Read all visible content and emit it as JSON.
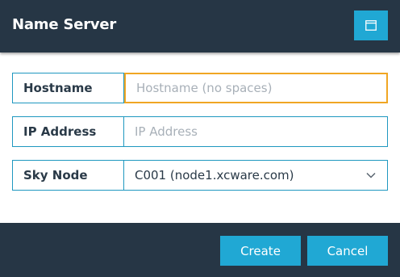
{
  "dialog": {
    "title": "Name Server"
  },
  "fields": {
    "hostname": {
      "label": "Hostname",
      "value": "",
      "placeholder": "Hostname (no spaces)"
    },
    "ip_address": {
      "label": "IP Address",
      "value": "",
      "placeholder": "IP Address"
    },
    "sky_node": {
      "label": "Sky Node",
      "value": "C001 (node1.xcware.com)"
    }
  },
  "footer": {
    "create_label": "Create",
    "cancel_label": "Cancel"
  },
  "colors": {
    "header_bg": "#263645",
    "accent": "#20a8d4",
    "focus_border": "#f0a623",
    "field_border": "#1f98c0"
  },
  "icons": {
    "header_button": "window-icon",
    "select_arrow": "chevron-down-icon"
  }
}
